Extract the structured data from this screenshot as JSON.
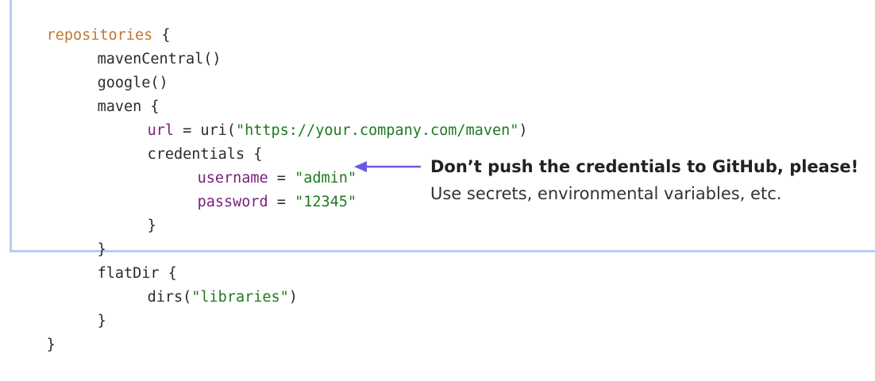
{
  "code": {
    "lines": [
      {
        "tokens": [
          {
            "text": "repositories",
            "kind": "kw"
          },
          {
            "text": " {",
            "kind": "plain"
          }
        ]
      },
      {
        "tokens": [
          {
            "text": "mavenCentral()",
            "kind": "plain"
          }
        ]
      },
      {
        "tokens": [
          {
            "text": "google()",
            "kind": "plain"
          }
        ]
      },
      {
        "tokens": [
          {
            "text": "maven {",
            "kind": "plain"
          }
        ]
      },
      {
        "tokens": [
          {
            "text": "url",
            "kind": "prop"
          },
          {
            "text": " = uri(",
            "kind": "plain"
          },
          {
            "text": "\"https://your.company.com/maven\"",
            "kind": "str"
          },
          {
            "text": ")",
            "kind": "plain"
          }
        ]
      },
      {
        "tokens": [
          {
            "text": "credentials {",
            "kind": "plain"
          }
        ]
      },
      {
        "tokens": [
          {
            "text": "username",
            "kind": "prop"
          },
          {
            "text": " = ",
            "kind": "plain"
          },
          {
            "text": "\"admin\"",
            "kind": "str"
          }
        ]
      },
      {
        "tokens": [
          {
            "text": "password",
            "kind": "prop"
          },
          {
            "text": " = ",
            "kind": "plain"
          },
          {
            "text": "\"12345\"",
            "kind": "str"
          }
        ]
      },
      {
        "tokens": [
          {
            "text": "}",
            "kind": "plain"
          }
        ]
      },
      {
        "tokens": [
          {
            "text": "}",
            "kind": "plain"
          }
        ]
      },
      {
        "tokens": [
          {
            "text": "flatDir {",
            "kind": "plain"
          }
        ]
      },
      {
        "tokens": [
          {
            "text": "dirs(",
            "kind": "plain"
          },
          {
            "text": "\"libraries\"",
            "kind": "str"
          },
          {
            "text": ")",
            "kind": "plain"
          }
        ]
      },
      {
        "tokens": [
          {
            "text": "}",
            "kind": "plain"
          }
        ]
      },
      {
        "tokens": [
          {
            "text": "}",
            "kind": "plain"
          }
        ]
      }
    ]
  },
  "annotation": {
    "title": "Don’t push the credentials to GitHub, please!",
    "body": "Use secrets, environmental variables, etc."
  },
  "colors": {
    "keyword": "#c0772f",
    "property": "#7a1f7a",
    "string": "#1f7a1f",
    "text": "#2b2b2b",
    "highlight_border": "#b9ccf3",
    "arrow": "#6a5ae0"
  }
}
